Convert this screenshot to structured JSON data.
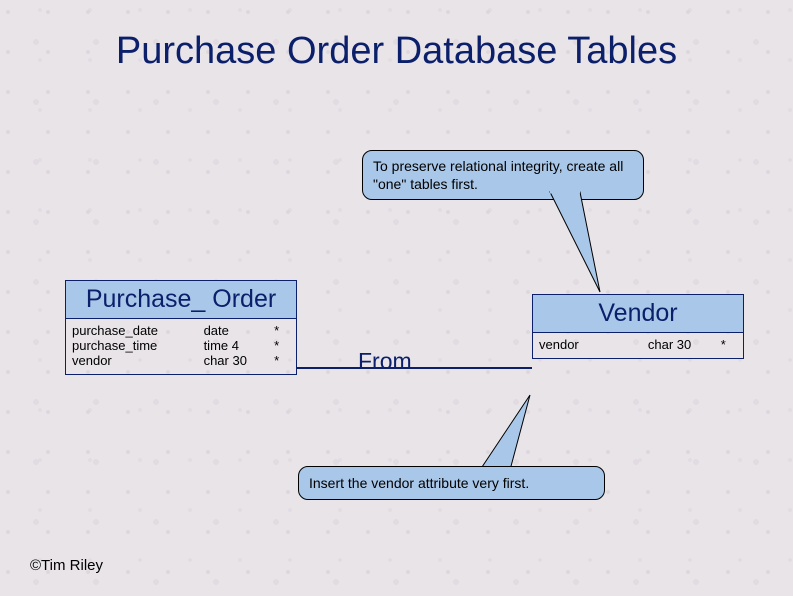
{
  "title": "Purchase Order Database Tables",
  "callout_top": "To preserve relational integrity, create all \"one\" tables first.",
  "entities": {
    "purchase_order": {
      "name": "Purchase_ Order",
      "rows": [
        {
          "attr": "purchase_date",
          "type": "date",
          "flag": "*"
        },
        {
          "attr": "purchase_time",
          "type": "time 4",
          "flag": "*"
        },
        {
          "attr": "vendor",
          "type": "char 30",
          "flag": "*"
        }
      ]
    },
    "vendor": {
      "name": "Vendor",
      "rows": [
        {
          "attr": "vendor",
          "type": "char 30",
          "flag": "*"
        }
      ]
    }
  },
  "relationship": {
    "label": "From"
  },
  "callout_bottom": "Insert the vendor attribute very first.",
  "footer": "©Tim Riley"
}
